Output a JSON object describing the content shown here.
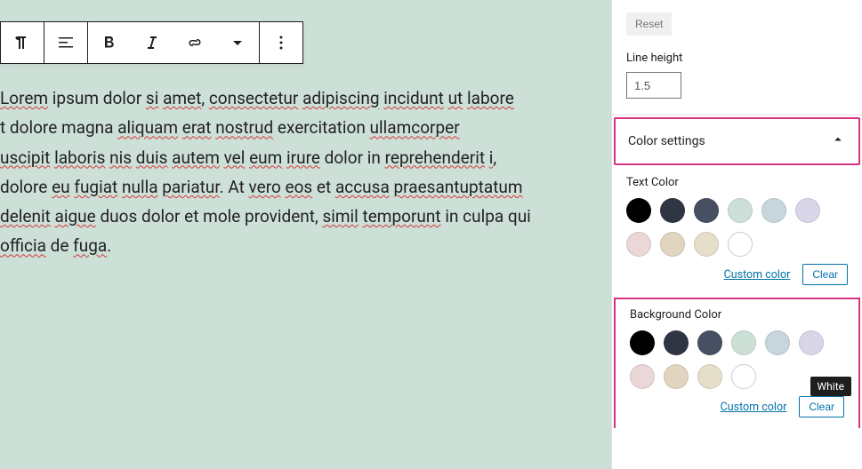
{
  "editor": {
    "text_parts": [
      {
        "t": "Lorem",
        "s": 1
      },
      {
        "t": " ipsum dolor ",
        "s": 0
      },
      {
        "t": "si",
        "s": 1
      },
      {
        "t": " ",
        "s": 0
      },
      {
        "t": "amet",
        "s": 1
      },
      {
        "t": ", ",
        "s": 0
      },
      {
        "t": "consectetur",
        "s": 1
      },
      {
        "t": " ",
        "s": 0
      },
      {
        "t": "adipiscing",
        "s": 1
      },
      {
        "t": " ",
        "s": 0
      },
      {
        "t": "incidunt",
        "s": 1
      },
      {
        "t": " ",
        "s": 0
      },
      {
        "t": "ut",
        "s": 1
      },
      {
        "t": " ",
        "s": 0
      },
      {
        "t": "labore",
        "s": 1
      },
      {
        "t": "t dolore magna ",
        "s": 0
      },
      {
        "t": "aliquam",
        "s": 1
      },
      {
        "t": " ",
        "s": 0
      },
      {
        "t": "erat",
        "s": 1
      },
      {
        "t": " ",
        "s": 0
      },
      {
        "t": "nostrud",
        "s": 1
      },
      {
        "t": " exercitation ",
        "s": 0
      },
      {
        "t": "ullamcorper",
        "s": 1
      },
      {
        "t": "uscipit",
        "s": 1
      },
      {
        "t": " ",
        "s": 0
      },
      {
        "t": "laboris",
        "s": 1
      },
      {
        "t": " ",
        "s": 0
      },
      {
        "t": "nis",
        "s": 1
      },
      {
        "t": " ",
        "s": 0
      },
      {
        "t": "duis",
        "s": 1
      },
      {
        "t": " ",
        "s": 0
      },
      {
        "t": "autem",
        "s": 1
      },
      {
        "t": " ",
        "s": 0
      },
      {
        "t": "vel",
        "s": 1
      },
      {
        "t": " ",
        "s": 0
      },
      {
        "t": "eum",
        "s": 1
      },
      {
        "t": " ",
        "s": 0
      },
      {
        "t": "irure",
        "s": 1
      },
      {
        "t": " dolor in ",
        "s": 0
      },
      {
        "t": "reprehenderit",
        "s": 1
      },
      {
        "t": " ",
        "s": 0
      },
      {
        "t": "i",
        "s": 1
      },
      {
        "t": ",",
        "s": 0
      },
      {
        "t": "dolore ",
        "s": 0
      },
      {
        "t": "eu",
        "s": 1
      },
      {
        "t": " ",
        "s": 0
      },
      {
        "t": "fugiat",
        "s": 1
      },
      {
        "t": " ",
        "s": 0
      },
      {
        "t": "nulla",
        "s": 1
      },
      {
        "t": " ",
        "s": 0
      },
      {
        "t": "pariatur",
        "s": 1
      },
      {
        "t": ". At ",
        "s": 0
      },
      {
        "t": "vero",
        "s": 1
      },
      {
        "t": " ",
        "s": 0
      },
      {
        "t": "eos",
        "s": 1
      },
      {
        "t": " et ",
        "s": 0
      },
      {
        "t": "accusa",
        "s": 1
      },
      {
        "t": " ",
        "s": 0
      },
      {
        "t": "praesant",
        "s": 1
      },
      {
        "t": "uptatum",
        "s": 1
      },
      {
        "t": " ",
        "s": 0
      },
      {
        "t": "delenit",
        "s": 1
      },
      {
        "t": " ",
        "s": 0
      },
      {
        "t": "aigue",
        "s": 1
      },
      {
        "t": " duos dolor et mole provident, ",
        "s": 0
      },
      {
        "t": "simil",
        "s": 1
      },
      {
        "t": " ",
        "s": 0
      },
      {
        "t": "tempor",
        "s": 1
      },
      {
        "t": "unt",
        "s": 1
      },
      {
        "t": " in culpa qui ",
        "s": 0
      },
      {
        "t": "officia",
        "s": 1
      },
      {
        "t": " de ",
        "s": 0
      },
      {
        "t": "fuga",
        "s": 1
      },
      {
        "t": ".",
        "s": 0
      }
    ],
    "line_breaks_after": [
      14,
      22,
      42,
      59,
      69
    ]
  },
  "sidebar": {
    "reset_label": "Reset",
    "line_height_label": "Line height",
    "line_height_value": "1.5",
    "color_settings_label": "Color settings",
    "text_color_label": "Text Color",
    "bg_color_label": "Background Color",
    "custom_color_label": "Custom color",
    "clear_label": "Clear",
    "tooltip_white": "White",
    "palette": [
      {
        "name": "black",
        "hex": "#000000"
      },
      {
        "name": "dark-gray",
        "hex": "#2f3542"
      },
      {
        "name": "slate",
        "hex": "#475063"
      },
      {
        "name": "pale-green",
        "hex": "#cde0d8"
      },
      {
        "name": "pale-blue",
        "hex": "#c7d6dd"
      },
      {
        "name": "pale-lavender",
        "hex": "#d9d6ea"
      },
      {
        "name": "pale-pink",
        "hex": "#ead7d7"
      },
      {
        "name": "pale-tan",
        "hex": "#e1d5c0"
      },
      {
        "name": "pale-cream",
        "hex": "#e5dec9"
      },
      {
        "name": "white",
        "hex": "#ffffff"
      }
    ]
  }
}
